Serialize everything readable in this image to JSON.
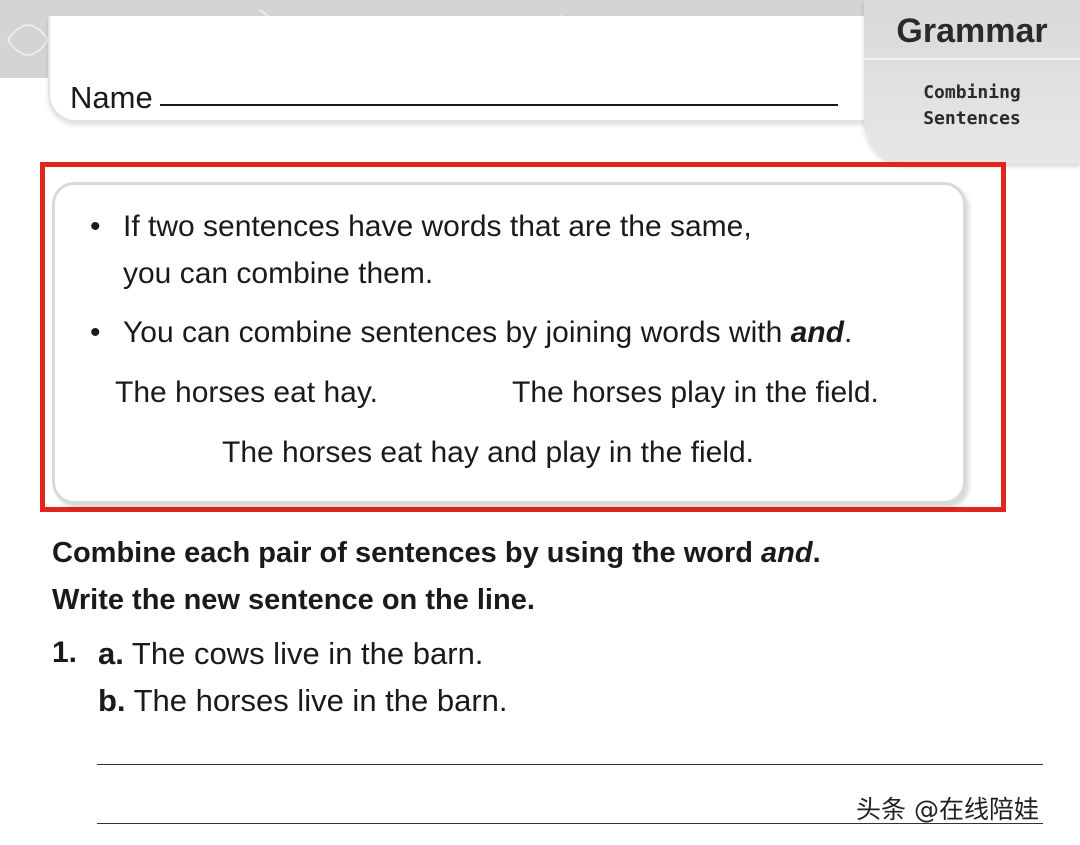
{
  "header": {
    "name_label": "Name",
    "tab_title": "Grammar",
    "tab_subtitle_line1": "Combining",
    "tab_subtitle_line2": "Sentences"
  },
  "rules": {
    "bullet1_line1": "If two sentences have words that are the same,",
    "bullet1_line2": "you can combine them.",
    "bullet2_prefix": "You can combine sentences by joining words with ",
    "bullet2_keyword": "and",
    "bullet2_suffix": ".",
    "example_left": "The horses eat hay.",
    "example_right": "The horses play in the field.",
    "example_combined": "The horses eat hay and play in the field."
  },
  "instructions": {
    "line1_prefix": "Combine each pair of sentences by using the word ",
    "line1_keyword": "and",
    "line1_suffix": ".",
    "line2": "Write the new sentence on the line."
  },
  "question1": {
    "number": "1.",
    "a_label": "a.",
    "a_text": " The cows live in the barn.",
    "b_label": "b.",
    "b_text": " The horses live in the barn."
  },
  "watermark": "头条 @在线陪娃",
  "colors": {
    "highlight_border": "#e0261d",
    "tab_gray": "#d9d9d9",
    "band_gray": "#d4d4d4"
  }
}
